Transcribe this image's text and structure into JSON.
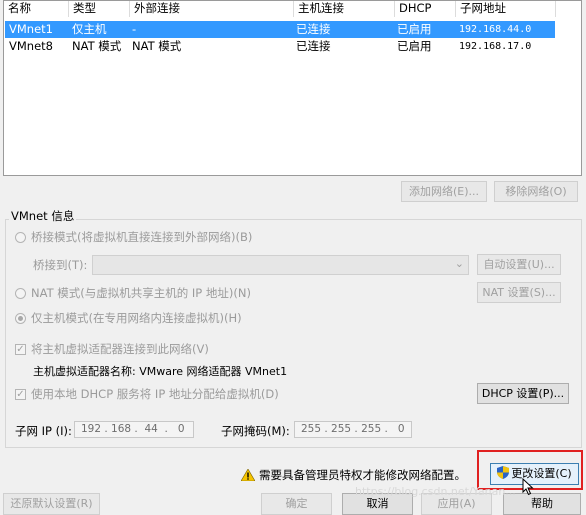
{
  "table": {
    "columns": [
      "名称",
      "类型",
      "外部连接",
      "主机连接",
      "DHCP",
      "子网地址"
    ],
    "rows": [
      {
        "name": "VMnet1",
        "type": "仅主机",
        "external": "-",
        "host": "已连接",
        "dhcp": "已启用",
        "subnet": "192.168.44.0",
        "selected": true
      },
      {
        "name": "VMnet8",
        "type": "NAT 模式",
        "external": "NAT 模式",
        "host": "已连接",
        "dhcp": "已启用",
        "subnet": "192.168.17.0",
        "selected": false
      }
    ]
  },
  "buttons": {
    "add_network": "添加网络(E)...",
    "remove_network": "移除网络(O)",
    "auto_settings": "自动设置(U)...",
    "nat_settings": "NAT 设置(S)...",
    "dhcp_settings": "DHCP 设置(P)...",
    "change_settings": "更改设置(C)",
    "restore_defaults": "还原默认设置(R)",
    "ok": "确定",
    "cancel": "取消",
    "apply": "应用(A)",
    "help": "帮助"
  },
  "vmnet_info": {
    "title": "VMnet 信息",
    "bridged_mode": "桥接模式(将虚拟机直接连接到外部网络)(B)",
    "bridged_to": "桥接到(T):",
    "bridged_to_value": "",
    "nat_mode": "NAT 模式(与虚拟机共享主机的 IP 地址)(N)",
    "host_only_mode": "仅主机模式(在专用网络内连接虚拟机)(H)",
    "selected_mode": "host_only",
    "connect_adapter": "将主机虚拟适配器连接到此网络(V)",
    "connect_adapter_checked": true,
    "adapter_name_label": "主机虚拟适配器名称: VMware 网络适配器 VMnet1",
    "use_dhcp": "使用本地 DHCP 服务将 IP 地址分配给虚拟机(D)",
    "use_dhcp_checked": true,
    "subnet_ip_label": "子网 IP (I):",
    "subnet_ip_value": "192 . 168 .  44  .   0",
    "subnet_mask_label": "子网掩码(M):",
    "subnet_mask_value": "255 . 255 . 255 .   0"
  },
  "admin_notice": "需要具备管理员特权才能修改网络配置。",
  "watermark": "https://blog.csdn.net/Yanan...",
  "colors": {
    "selection": "#3399ff",
    "highlight_border": "#e02020",
    "warning": "#f5c400"
  },
  "icons": {
    "warning": "warning-triangle-icon",
    "shield": "uac-shield-icon",
    "dropdown": "chevron-down-icon"
  }
}
